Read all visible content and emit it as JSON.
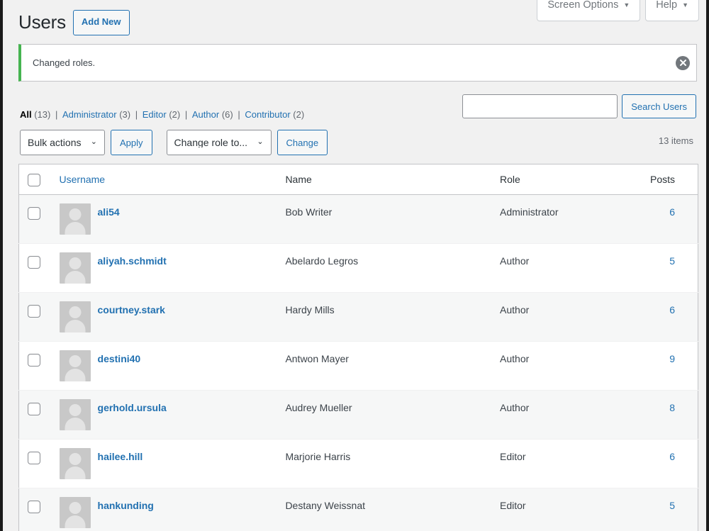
{
  "screen_meta": {
    "tabs": [
      {
        "label": "Screen Options",
        "caret": "▼"
      },
      {
        "label": "Help",
        "caret": "▼"
      }
    ]
  },
  "header": {
    "title": "Users",
    "add_new_label": "Add New"
  },
  "notice": {
    "message": "Changed roles.",
    "dismiss_label": "Dismiss this notice",
    "accent_color": "#46b450"
  },
  "filters": {
    "items": [
      {
        "label": "All",
        "count": "(13)",
        "current": true
      },
      {
        "label": "Administrator",
        "count": "(3)",
        "current": false
      },
      {
        "label": "Editor",
        "count": "(2)",
        "current": false
      },
      {
        "label": "Author",
        "count": "(6)",
        "current": false
      },
      {
        "label": "Contributor",
        "count": "(2)",
        "current": false
      }
    ],
    "separator": "|"
  },
  "search": {
    "value": "",
    "placeholder": "",
    "button_label": "Search Users"
  },
  "tablenav": {
    "bulk_actions_label": "Bulk actions",
    "apply_label": "Apply",
    "change_role_label": "Change role to...",
    "change_label": "Change",
    "caret": "⌄",
    "displaying_num": "13 items"
  },
  "table": {
    "columns": {
      "username": "Username",
      "name": "Name",
      "role": "Role",
      "posts": "Posts"
    },
    "rows": [
      {
        "username": "ali54",
        "name": "Bob Writer",
        "role": "Administrator",
        "posts": "6"
      },
      {
        "username": "aliyah.schmidt",
        "name": "Abelardo Legros",
        "role": "Author",
        "posts": "5"
      },
      {
        "username": "courtney.stark",
        "name": "Hardy Mills",
        "role": "Author",
        "posts": "6"
      },
      {
        "username": "destini40",
        "name": "Antwon Mayer",
        "role": "Author",
        "posts": "9"
      },
      {
        "username": "gerhold.ursula",
        "name": "Audrey Mueller",
        "role": "Author",
        "posts": "8"
      },
      {
        "username": "hailee.hill",
        "name": "Marjorie Harris",
        "role": "Editor",
        "posts": "6"
      },
      {
        "username": "hankunding",
        "name": "Destany Weissnat",
        "role": "Editor",
        "posts": "5"
      }
    ]
  },
  "colors": {
    "link": "#2271b1",
    "page_bg": "#f1f1f1",
    "notice_green": "#46b450"
  }
}
